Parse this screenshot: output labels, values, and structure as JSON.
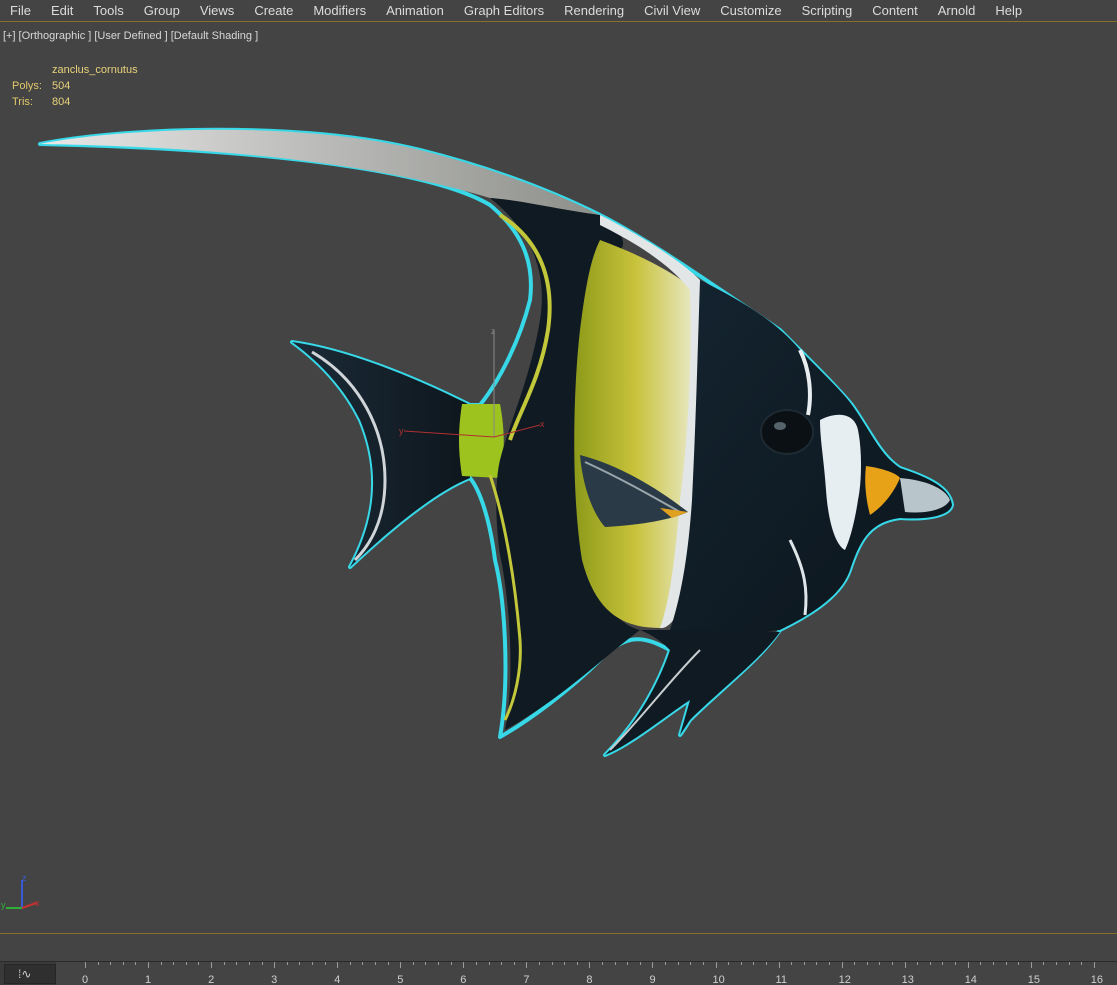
{
  "menu": {
    "items": [
      "File",
      "Edit",
      "Tools",
      "Group",
      "Views",
      "Create",
      "Modifiers",
      "Animation",
      "Graph Editors",
      "Rendering",
      "Civil View",
      "Customize",
      "Scripting",
      "Content",
      "Arnold",
      "Help"
    ]
  },
  "viewport": {
    "label_plus": "[+]",
    "label_view": "[Orthographic ]",
    "label_camera": "[User Defined ]",
    "label_shading": "[Default Shading ]",
    "stats": {
      "object_name": "zanclus_cornutus",
      "polys_label": "Polys:",
      "polys_value": "504",
      "tris_label": "Tris:",
      "tris_value": "804"
    },
    "gizmo": {
      "x_label": "x",
      "y_label": "y",
      "z_label": "z"
    },
    "axis_tripod": {
      "x_label": "x",
      "y_label": "y",
      "z_label": "z"
    }
  },
  "timeline": {
    "curve_editor_icon": "curve-editor-icon",
    "ticks": [
      "0",
      "1",
      "2",
      "3",
      "4",
      "5",
      "6",
      "7",
      "8",
      "9",
      "10",
      "11",
      "12",
      "13",
      "14",
      "15",
      "16"
    ]
  },
  "colors": {
    "selection_outline": "#37d8e8",
    "menu_border": "#8a6d2b",
    "stats_text": "#e8d27a",
    "background": "#444444"
  }
}
